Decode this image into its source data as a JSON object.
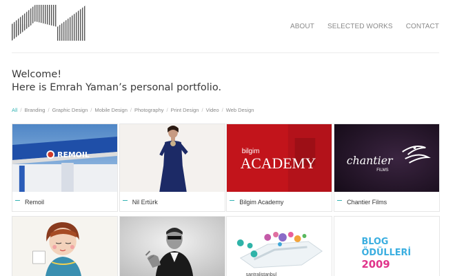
{
  "nav": {
    "items": [
      {
        "label": "ABOUT"
      },
      {
        "label": "SELECTED WORKS"
      },
      {
        "label": "CONTACT"
      }
    ]
  },
  "welcome": {
    "line1": "Welcome!",
    "line2": "Here is Emrah Yaman’s personal portfolio."
  },
  "filters": {
    "items": [
      "All",
      "Branding",
      "Graphic Design",
      "Mobile Design",
      "Photography",
      "Print Design",
      "Video",
      "Web Design"
    ],
    "active": "All",
    "accent": "#33b3b3"
  },
  "works": [
    {
      "title": "Remoil",
      "thumb_text": "REMOIL"
    },
    {
      "title": "Nil Ertürk"
    },
    {
      "title": "Bilgim Academy",
      "thumb_text_small": "bilgim",
      "thumb_text_big": "ACADEMY"
    },
    {
      "title": "Chantier Films",
      "thumb_text": "chantier",
      "thumb_text_small": "FILMS"
    },
    {
      "title": ""
    },
    {
      "title": ""
    },
    {
      "title": "",
      "thumb_text": "santralistanbul"
    },
    {
      "title": "",
      "thumb_line1": "BLOG",
      "thumb_line2": "ÖDÜLLERİ",
      "thumb_line3": "2009"
    }
  ]
}
